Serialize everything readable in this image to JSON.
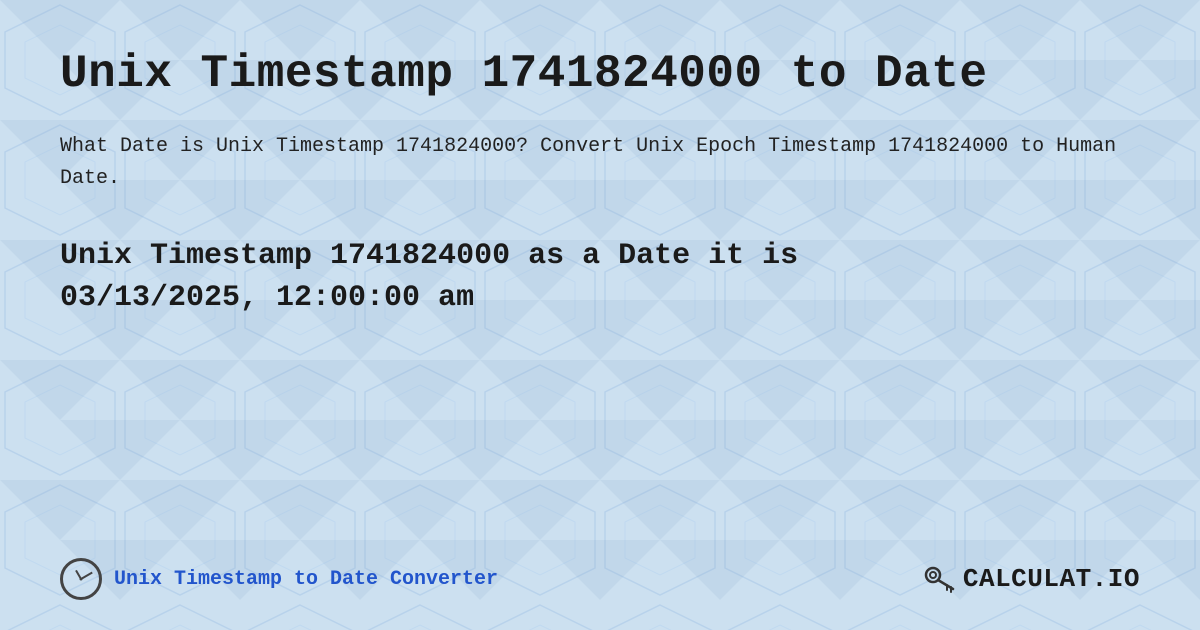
{
  "page": {
    "title": "Unix Timestamp 1741824000 to Date",
    "description": "What Date is Unix Timestamp 1741824000? Convert Unix Epoch Timestamp 1741824000 to Human Date.",
    "result_line1": "Unix Timestamp 1741824000 as a Date it is",
    "result_line2": "03/13/2025, 12:00:00 am",
    "footer_link_text": "Unix Timestamp to Date Converter",
    "logo_text": "CALCULAT.IO",
    "background_color": "#c8dff0"
  }
}
